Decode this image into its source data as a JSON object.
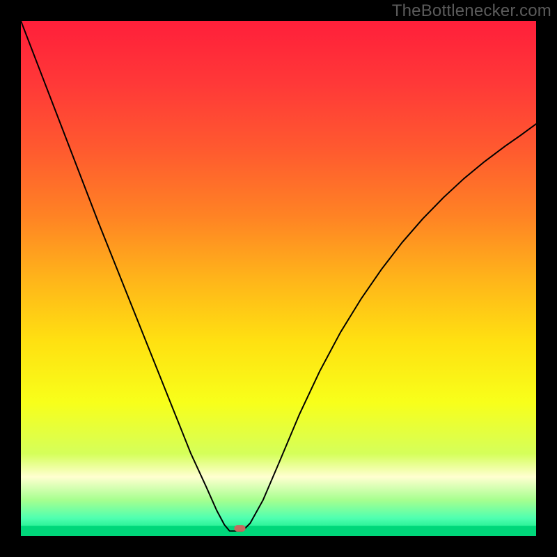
{
  "watermark": "TheBottlenecker.com",
  "chart_data": {
    "type": "line",
    "title": "",
    "xlabel": "",
    "ylabel": "",
    "xlim": [
      0,
      1
    ],
    "ylim": [
      0,
      1
    ],
    "grid": false,
    "legend": false,
    "background": {
      "kind": "vertical-gradient",
      "stops": [
        {
          "offset": 0.0,
          "color": "#ff1f3a"
        },
        {
          "offset": 0.12,
          "color": "#ff3838"
        },
        {
          "offset": 0.25,
          "color": "#ff5a2f"
        },
        {
          "offset": 0.38,
          "color": "#ff8324"
        },
        {
          "offset": 0.5,
          "color": "#ffb41a"
        },
        {
          "offset": 0.62,
          "color": "#ffe011"
        },
        {
          "offset": 0.74,
          "color": "#f8ff1a"
        },
        {
          "offset": 0.84,
          "color": "#d5ff5a"
        },
        {
          "offset": 0.885,
          "color": "#ffffd0"
        },
        {
          "offset": 0.93,
          "color": "#a6ff8f"
        },
        {
          "offset": 0.965,
          "color": "#4fffb0"
        },
        {
          "offset": 1.0,
          "color": "#00e57c"
        }
      ]
    },
    "series": [
      {
        "name": "left-branch",
        "color": "#000000",
        "width": 2,
        "x": [
          0.0,
          0.05,
          0.1,
          0.15,
          0.2,
          0.25,
          0.3,
          0.33,
          0.36,
          0.38,
          0.395,
          0.405,
          0.41
        ],
        "y": [
          1.0,
          0.87,
          0.74,
          0.61,
          0.485,
          0.36,
          0.235,
          0.16,
          0.095,
          0.05,
          0.022,
          0.01,
          0.01
        ]
      },
      {
        "name": "right-branch",
        "color": "#000000",
        "width": 2,
        "x": [
          0.43,
          0.445,
          0.47,
          0.5,
          0.54,
          0.58,
          0.62,
          0.66,
          0.7,
          0.74,
          0.78,
          0.82,
          0.86,
          0.9,
          0.94,
          0.97,
          1.0
        ],
        "y": [
          0.01,
          0.025,
          0.07,
          0.14,
          0.235,
          0.32,
          0.395,
          0.46,
          0.518,
          0.57,
          0.616,
          0.657,
          0.694,
          0.727,
          0.757,
          0.778,
          0.8
        ]
      },
      {
        "name": "trough-flat",
        "color": "#000000",
        "width": 2,
        "x": [
          0.41,
          0.43
        ],
        "y": [
          0.01,
          0.01
        ]
      }
    ],
    "markers": [
      {
        "name": "trough-capsule",
        "shape": "capsule",
        "cx": 0.425,
        "cy": 0.015,
        "w": 0.022,
        "h": 0.013,
        "fill": "#c56a5f"
      }
    ],
    "bottom_stripe": {
      "comment": "solid green band below the gradient",
      "color": "#00d77a",
      "y_frac_from_bottom": 0.0,
      "height_frac": 0.02
    }
  }
}
